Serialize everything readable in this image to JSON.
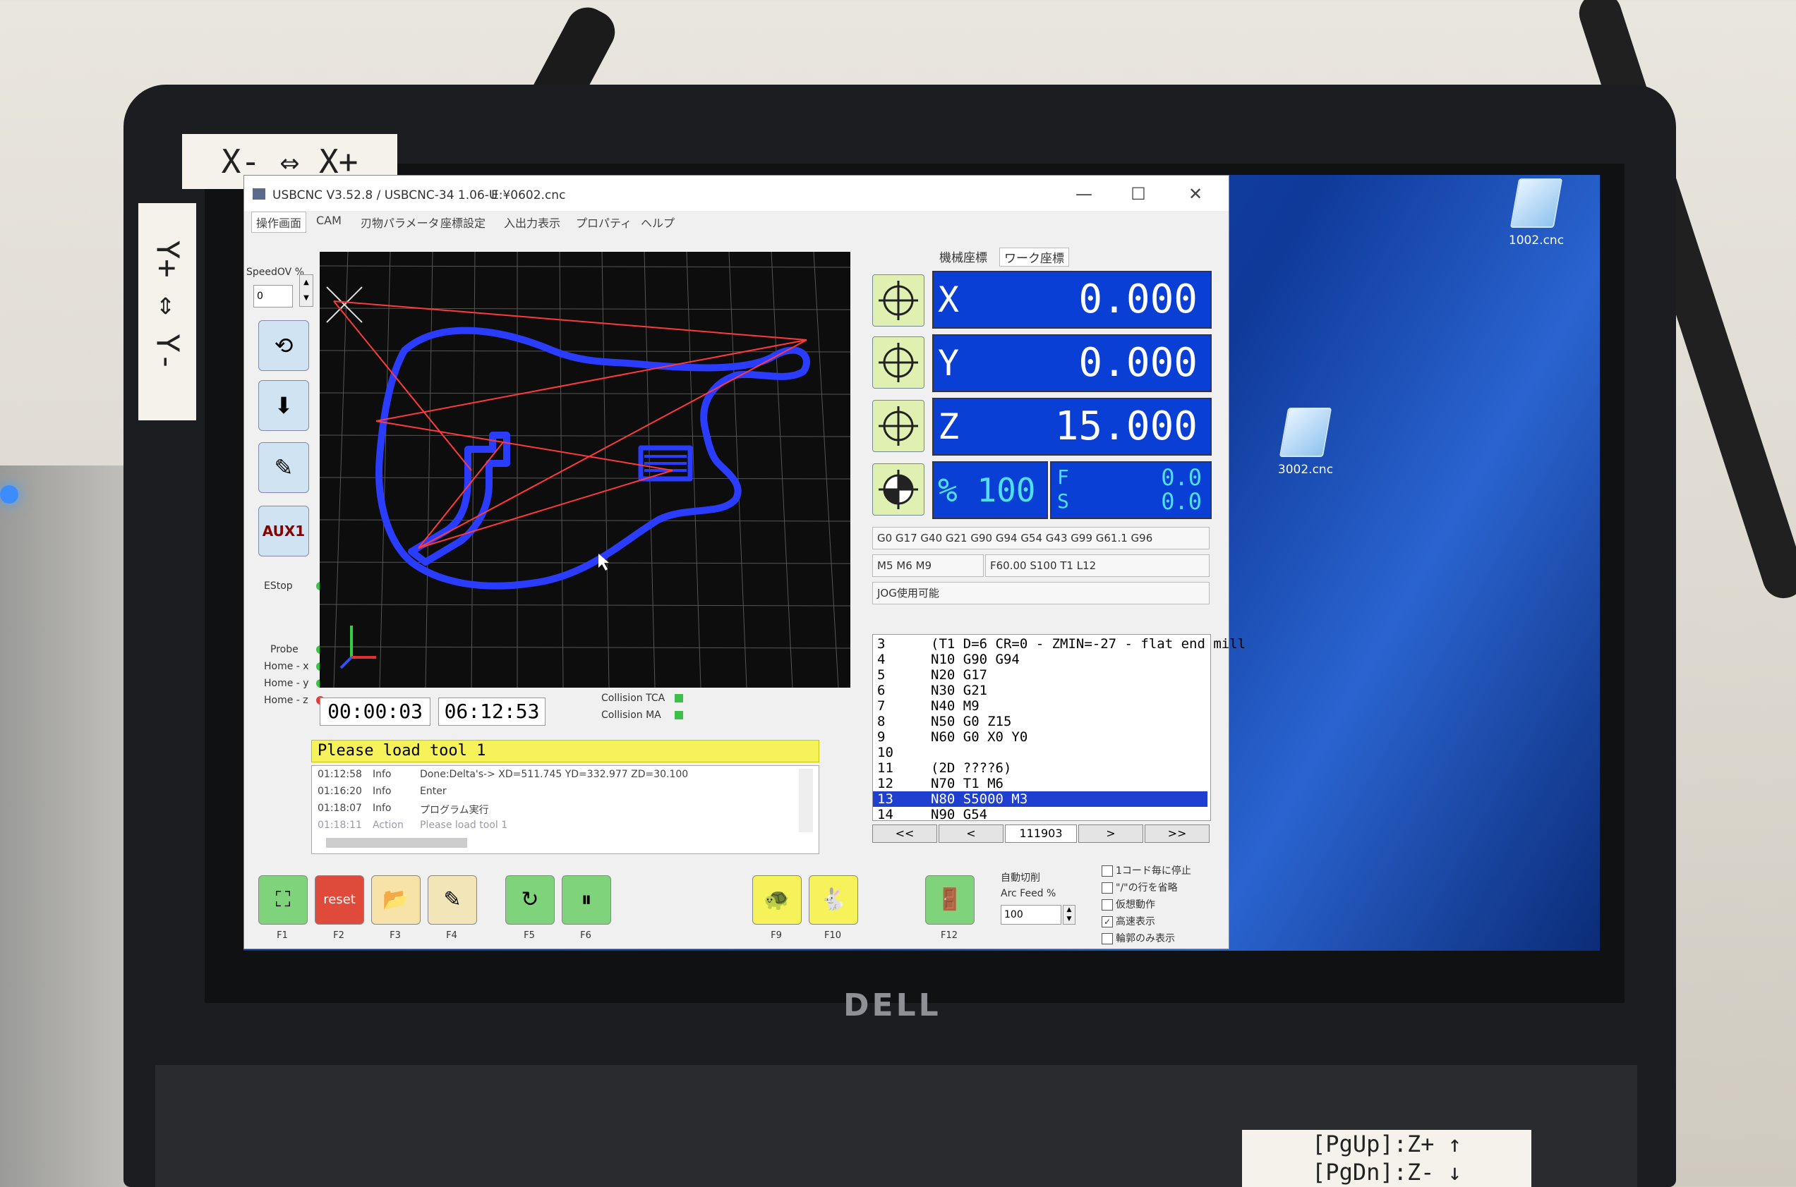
{
  "physical_labels": {
    "x_axis": "X- ⇔ X+",
    "y_axis": "Y+ ⇔ Y-",
    "pg_up": "[PgUp]:Z+ ↑",
    "pg_dn": "[PgDn]:Z- ↓",
    "laptop_brand": "DELL"
  },
  "desktop": {
    "icons": [
      {
        "name": "1002.cnc"
      },
      {
        "name": "3002.cnc"
      }
    ]
  },
  "window": {
    "title": "USBCNC V3.52.8 / USBCNC-34 1.06-U",
    "file": "E:¥0602.cnc",
    "controls": {
      "minimize": "—",
      "maximize": "☐",
      "close": "✕"
    }
  },
  "menu": [
    "操作画面",
    "CAM",
    "刃物パラメータ",
    "座標設定",
    "入出力表示",
    "プロパティ",
    "ヘルプ"
  ],
  "left_panel": {
    "speedov_label": "SpeedOV %",
    "speedov_value": "0",
    "aux1": "AUX1",
    "estop": "EStop",
    "probe": "Probe",
    "home_x": "Home - x",
    "home_y": "Home - y",
    "home_z": "Home - z"
  },
  "timers": {
    "elapsed": "00:00:03",
    "total": "06:12:53"
  },
  "collision": {
    "tca": "Collision TCA",
    "ma": "Collision MA"
  },
  "banner": "Please load tool 1",
  "log": [
    {
      "time": "01:12:58",
      "level": "Info",
      "msg": "Done:Delta's-> XD=511.745 YD=332.977 ZD=30.100"
    },
    {
      "time": "01:16:20",
      "level": "Info",
      "msg": "Enter"
    },
    {
      "time": "01:18:07",
      "level": "Info",
      "msg": "プログラム実行"
    },
    {
      "time": "01:18:11",
      "level": "Action",
      "msg": "Please load tool 1"
    }
  ],
  "function_keys": {
    "f1": "F1",
    "f2": "F2",
    "f2_text": "reset",
    "f3": "F3",
    "f4": "F4",
    "f5": "F5",
    "f6": "F6",
    "f9": "F9",
    "f10": "F10",
    "f12": "F12"
  },
  "coord_tabs": [
    "機械座標",
    "ワーク座標"
  ],
  "dro": {
    "x": {
      "label": "X",
      "value": "0.000"
    },
    "y": {
      "label": "Y",
      "value": "0.000"
    },
    "z": {
      "label": "Z",
      "value": "15.000"
    },
    "feed_pct": "% 100",
    "f_label": "F",
    "s_label": "S",
    "f_value": "0.0",
    "s_value": "0.0"
  },
  "modal": {
    "gcodes": "G0 G17 G40 G21 G90 G94 G54 G43 G99 G61.1 G96",
    "mcodes": "M5 M6 M9",
    "fst": "F60.00 S100 T1 L12",
    "jog": "JOG使用可能"
  },
  "gcode_lines": [
    {
      "n": "3",
      "code": "(T1 D=6 CR=0 - ZMIN=-27 - flat end mill",
      "selected": false
    },
    {
      "n": "4",
      "code": "N10 G90 G94",
      "selected": false
    },
    {
      "n": "5",
      "code": "N20 G17",
      "selected": false
    },
    {
      "n": "6",
      "code": "N30 G21",
      "selected": false
    },
    {
      "n": "7",
      "code": "N40 M9",
      "selected": false
    },
    {
      "n": "8",
      "code": "N50 G0 Z15",
      "selected": false
    },
    {
      "n": "9",
      "code": "N60 G0 X0 Y0",
      "selected": false
    },
    {
      "n": "10",
      "code": "",
      "selected": false
    },
    {
      "n": "11",
      "code": "(2D ????6)",
      "selected": false
    },
    {
      "n": "12",
      "code": "N70 T1 M6",
      "selected": false
    },
    {
      "n": "13",
      "code": "N80 S5000 M3",
      "selected": true
    },
    {
      "n": "14",
      "code": "N90 G54",
      "selected": false
    }
  ],
  "nav": {
    "first": "<<",
    "prev": "<",
    "line": "111903",
    "next": ">",
    "last": ">>"
  },
  "options": {
    "auto_cut": "自動切削",
    "arc_feed_label": "Arc Feed %",
    "arc_feed_value": "100",
    "checks": [
      {
        "label": "1コード毎に停止",
        "checked": false
      },
      {
        "label": "\"/\"の行を省略",
        "checked": false
      },
      {
        "label": "仮想動作",
        "checked": false
      },
      {
        "label": "高速表示",
        "checked": true
      },
      {
        "label": "輪郭のみ表示",
        "checked": false
      }
    ]
  },
  "colors": {
    "dro_bg": "#0a3fd6",
    "toolpath": "#2a3cff",
    "rapid": "#ff3a3a",
    "banner": "#f6f25a",
    "selected_line": "#1e3fd0"
  }
}
